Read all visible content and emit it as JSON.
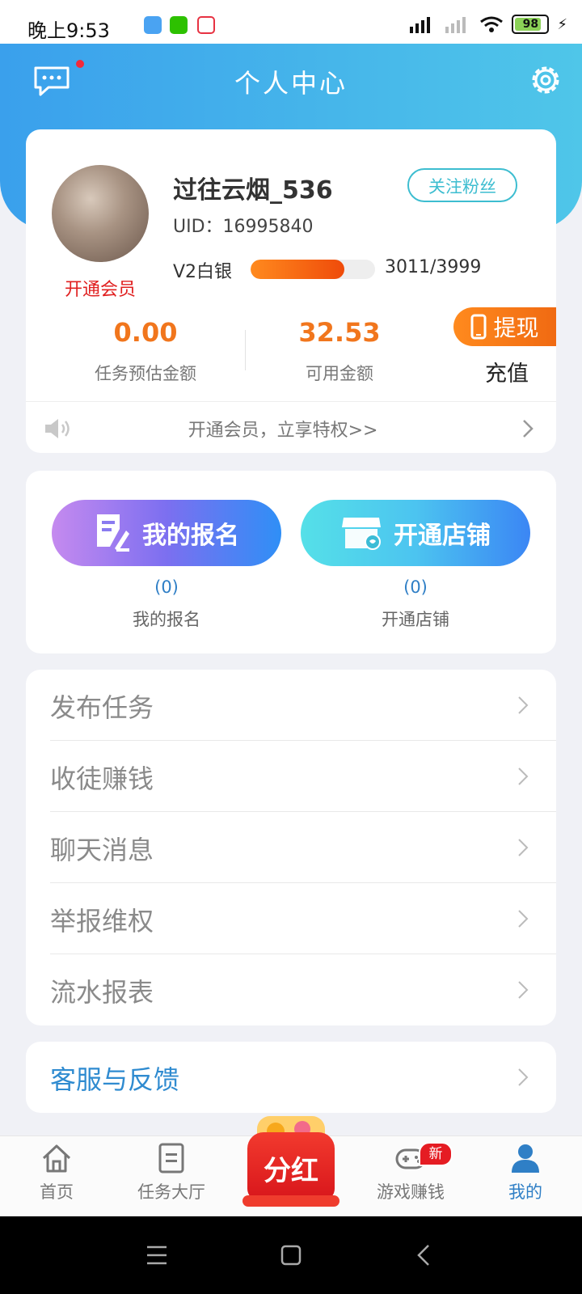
{
  "status_bar": {
    "time": "晚上9:53",
    "battery": "98"
  },
  "header": {
    "title": "个人中心"
  },
  "profile": {
    "username": "过往云烟_536",
    "uid": "UID：16995840",
    "follow_label": "关注粉丝",
    "vip_label": "开通会员",
    "level_name": "V2白银",
    "level_progress_text": "3011/3999",
    "level_progress_fraction": 0.75,
    "stats": [
      {
        "value": "0.00",
        "label": "任务预估金额"
      },
      {
        "value": "32.53",
        "label": "可用金额"
      }
    ],
    "withdraw_label": "提现",
    "recharge_label": "充值",
    "notice": "开通会员，立享特权>>"
  },
  "actions": [
    {
      "label": "我的报名",
      "count": "(0)",
      "caption": "我的报名"
    },
    {
      "label": "开通店铺",
      "count": "(0)",
      "caption": "开通店铺"
    }
  ],
  "menu": [
    "发布任务",
    "收徒赚钱",
    "聊天消息",
    "举报维权",
    "流水报表"
  ],
  "support": {
    "label": "客服与反馈"
  },
  "tabs": {
    "home": "首页",
    "tasks": "任务大厅",
    "dividend": "分红",
    "games": "游戏赚钱",
    "games_badge": "新",
    "me": "我的"
  },
  "colors": {
    "accent": "#3aa0ec",
    "orange": "#f1761d",
    "link": "#2f8bd0"
  }
}
